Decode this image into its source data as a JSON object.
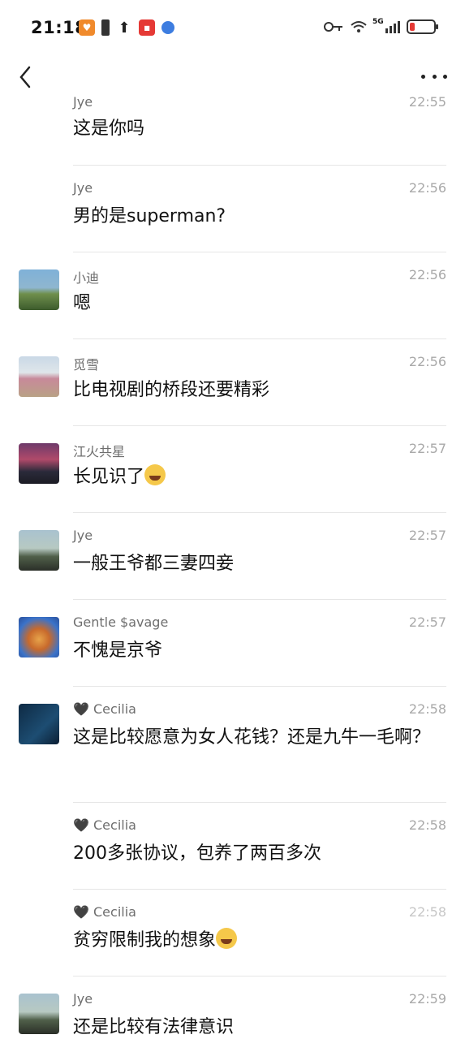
{
  "status_bar": {
    "time": "21:18",
    "network": "5G"
  },
  "nav": {
    "back_icon": "chevron-left-icon",
    "more_icon": "more-dots-icon"
  },
  "messages": [
    {
      "name": "Jye",
      "time": "22:55",
      "text": "这是你吗",
      "avatar": false
    },
    {
      "name": "Jye",
      "time": "22:56",
      "text": "男的是superman?",
      "avatar": false
    },
    {
      "name": "小迪",
      "time": "22:56",
      "text": "嗯",
      "avatar": true,
      "avatar_colors": [
        "#7fb1d8",
        "#6f8f4d"
      ]
    },
    {
      "name": "觅雪",
      "time": "22:56",
      "text": "比电视剧的桥段还要精彩",
      "avatar": true,
      "avatar_colors": [
        "#c9d8e6",
        "#b9a186"
      ]
    },
    {
      "name": "江火共星",
      "time": "22:57",
      "text": "长见识了",
      "avatar": true,
      "avatar_colors": [
        "#6e3a6a",
        "#2a2a3a"
      ],
      "emoji": true
    },
    {
      "name": "Jye",
      "time": "22:57",
      "text": "一般王爷都三妻四妾",
      "avatar": true,
      "avatar_colors": [
        "#a9c2cf",
        "#50604a"
      ]
    },
    {
      "name": "Gentle $avage",
      "time": "22:57",
      "text": "不愧是京爷",
      "avatar": true,
      "avatar_colors": [
        "#3b73c9",
        "#e7a34a"
      ]
    },
    {
      "name": "🖤 Cecilia",
      "time": "22:58",
      "text": "这是比较愿意为女人花钱？还是九牛一毛啊？",
      "avatar": true,
      "avatar_colors": [
        "#0e2a44",
        "#1d4d72"
      ]
    },
    {
      "name": "🖤 Cecilia",
      "time": "22:58",
      "text": "200多张协议，包养了两百多次",
      "avatar": false
    },
    {
      "name": "🖤 Cecilia",
      "time": "22:58",
      "text": "贫穷限制我的想象",
      "avatar": false,
      "emoji": true
    },
    {
      "name": "Jye",
      "time": "22:59",
      "text": "还是比较有法律意识",
      "avatar": true,
      "avatar_colors": [
        "#a9c2cf",
        "#50604a"
      ]
    }
  ]
}
